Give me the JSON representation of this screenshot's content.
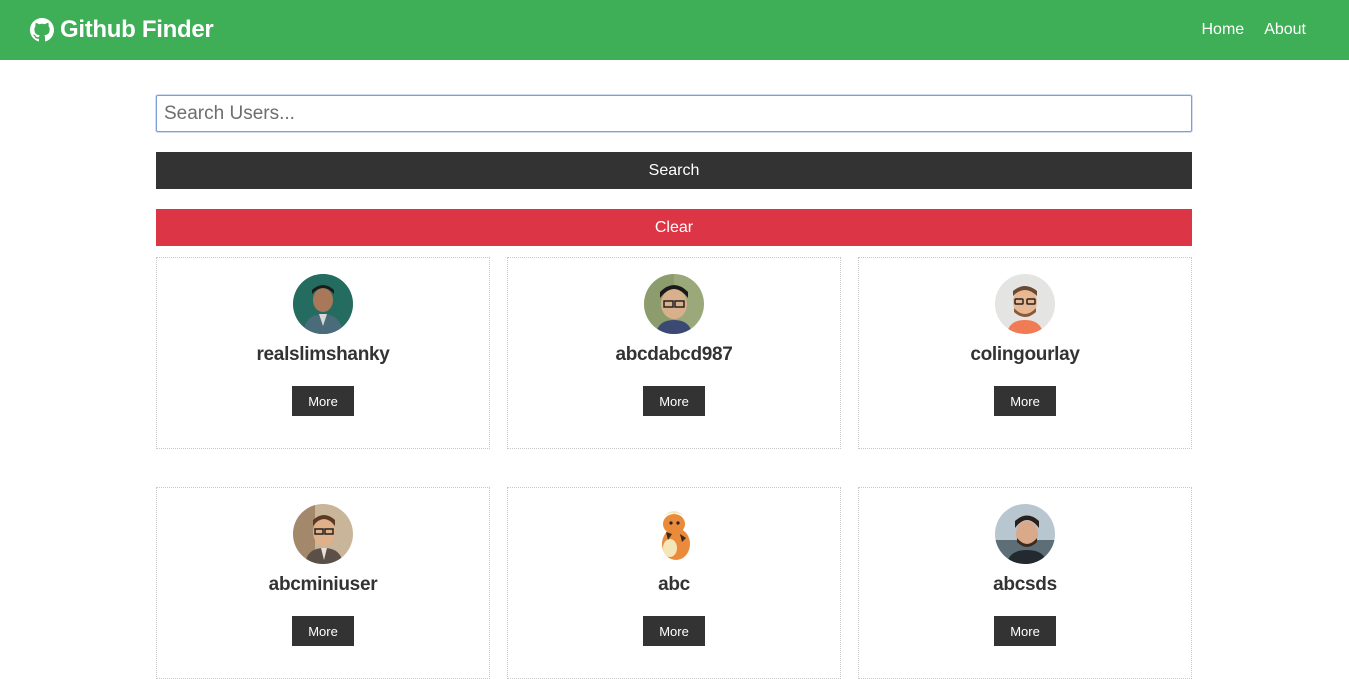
{
  "navbar": {
    "brand_title": "Github Finder",
    "brand_icon": "github-icon",
    "links": [
      {
        "label": "Home"
      },
      {
        "label": "About"
      }
    ],
    "background_color": "#3eaf56"
  },
  "search": {
    "placeholder": "Search Users...",
    "value": "",
    "search_button_label": "Search",
    "clear_button_label": "Clear"
  },
  "users": [
    {
      "login": "realslimshanky",
      "more_label": "More",
      "avatar_icon": "user-avatar-photo"
    },
    {
      "login": "abcdabcd987",
      "more_label": "More",
      "avatar_icon": "user-avatar-photo"
    },
    {
      "login": "colingourlay",
      "more_label": "More",
      "avatar_icon": "user-avatar-photo"
    },
    {
      "login": "abcminiuser",
      "more_label": "More",
      "avatar_icon": "user-avatar-photo"
    },
    {
      "login": "abc",
      "more_label": "More",
      "avatar_icon": "pokemon-avatar-image"
    },
    {
      "login": "abcsds",
      "more_label": "More",
      "avatar_icon": "user-avatar-photo"
    }
  ],
  "colors": {
    "primary": "#3eaf56",
    "dark": "#333333",
    "danger": "#dc3545"
  }
}
